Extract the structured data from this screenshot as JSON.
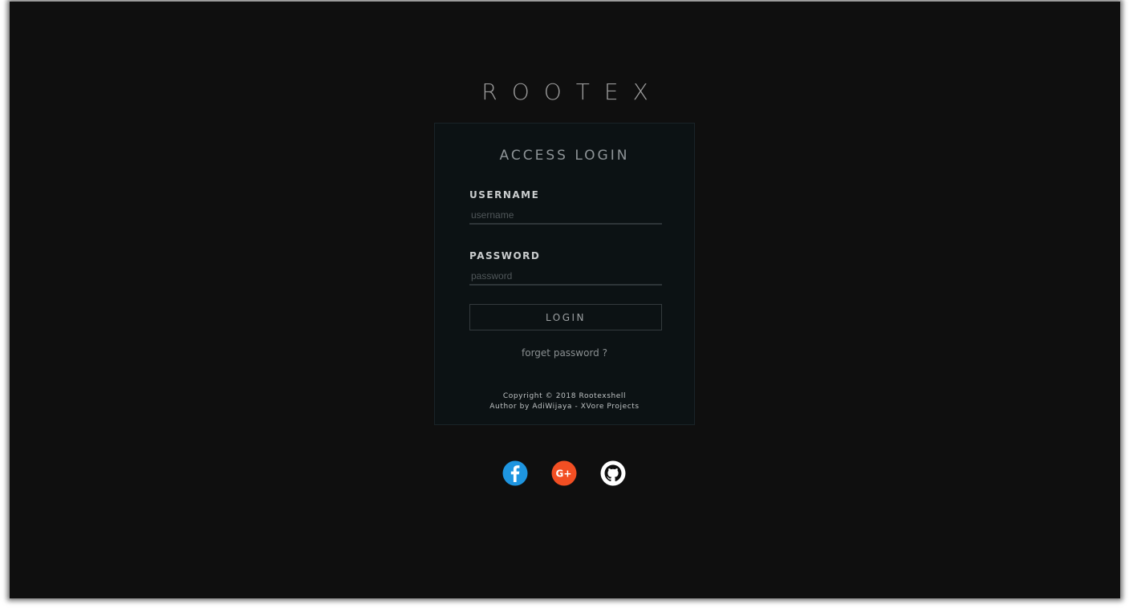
{
  "brand": "ROOTEX",
  "login": {
    "title": "ACCESS LOGIN",
    "username_label": "USERNAME",
    "username_placeholder": "username",
    "password_label": "PASSWORD",
    "password_placeholder": "password",
    "button": "LOGIN",
    "forget": "forget password ?",
    "copyright": "Copyright © 2018 Rootexshell",
    "author": "Author by AdiWijaya - XVore Projects"
  },
  "socials": [
    {
      "icon": "facebook-icon",
      "color": "#1e95e0"
    },
    {
      "icon": "google-plus-icon",
      "color": "#f24f23"
    },
    {
      "icon": "github-icon",
      "color": "#ffffff"
    }
  ]
}
